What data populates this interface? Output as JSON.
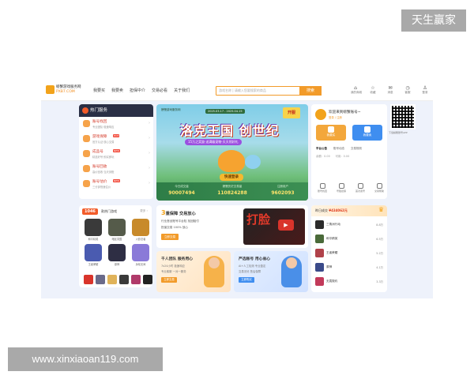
{
  "watermark": {
    "top": "天生赢家",
    "bottom": "www.xinxiaoan119.com"
  },
  "site": {
    "logo_line1": "螃蟹游戏服务网",
    "logo_line2": "PXB7.COM"
  },
  "nav": [
    "我要买",
    "我要卖",
    "担保中介",
    "交易必看",
    "关于我们"
  ],
  "search": {
    "placeholder": "游戏名称 | 请输入您要搜索的商品",
    "button": "搜索"
  },
  "tools": [
    {
      "icon": "⌂",
      "label": "我的商城"
    },
    {
      "icon": "☆",
      "label": "收藏"
    },
    {
      "icon": "✉",
      "label": "消息"
    },
    {
      "icon": "◷",
      "label": "客服"
    },
    {
      "icon": "♙",
      "label": "登录"
    }
  ],
  "hot": {
    "title": "热门服务",
    "items": [
      {
        "title": "账号找回",
        "sub": "专业团队·极速响应",
        "tag": ""
      },
      {
        "title": "游戏保障",
        "sub": "官方认证·放心交易",
        "tag": "HOT"
      },
      {
        "title": "成品号",
        "sub": "精选好号·即买即玩",
        "tag": "NEW"
      },
      {
        "title": "账号回收",
        "sub": "高价回收·当天到账",
        "tag": ""
      },
      {
        "title": "账号估价",
        "sub": "三分钟快速估价",
        "tag": "NEW"
      }
    ]
  },
  "banner": {
    "brand": "螃蟹游戏服务网",
    "date": "2025.03.17 - 2025.04.15",
    "badge": "开服",
    "title": "洛克王国 创世纪",
    "sub": "15万之奖励·送满级宠物·天天领好礼",
    "cta": "快速登录",
    "stats": [
      {
        "label": "今日成交量",
        "value": "90007494"
      },
      {
        "label": "螃蟹历史交易量",
        "value": "110824288"
      },
      {
        "label": "注册用户",
        "value": "9602093"
      }
    ]
  },
  "welcome": {
    "hi": "欢迎来到螃蟹账号~",
    "sub": "登录 / 注册",
    "buttons": [
      {
        "label": "我要买"
      },
      {
        "label": "我要卖"
      }
    ],
    "tabs": [
      "平台公告",
      "账号动态",
      "交易规则"
    ],
    "balance": "余额：0.00　　可用：0.00",
    "icons": [
      "账号找回",
      "号贩担保",
      "首次卖号",
      "交易帮助"
    ]
  },
  "qr": {
    "label": "下载螃蟹账号APP"
  },
  "games": {
    "badge": "1046",
    "title": "款热门游戏",
    "more": "更多 ›",
    "items": [
      "和平精英",
      "暗区突围",
      "火影忍者",
      "王者荣耀",
      "原神",
      "永劫无间"
    ]
  },
  "svc": {
    "title_num": "3",
    "title": "重保障 交易放心",
    "line1": "行业首创账号平台险 找回赔付",
    "line2": "担保交易 100% 放心",
    "button": "立即交易",
    "promo": "打脸"
  },
  "teams": [
    {
      "title": "千人团队 服务用心",
      "d1": "7x24小时 极速响应",
      "d2": "专业客服 一对一服务",
      "button": "立即交易"
    },
    {
      "title": "严选账号 用心省心",
      "d1": "AI+人工检测 专业鉴定",
      "d2": "交易无忧 售后保障",
      "button": "立即购买"
    }
  ],
  "rank": {
    "title": "昨日成交",
    "amount": "¥434062元",
    "rows": [
      {
        "name": "三角洲行动",
        "value": "8.8万"
      },
      {
        "name": "和平精英",
        "value": "6.5万"
      },
      {
        "name": "王者荣耀",
        "value": "5.2万"
      },
      {
        "name": "原神",
        "value": "4.1万"
      },
      {
        "name": "无畏契约",
        "value": "3.3万"
      }
    ]
  },
  "colors": {
    "accent": "#f29b2a",
    "dark": "#2a2f45",
    "red": "#e03a1a"
  }
}
